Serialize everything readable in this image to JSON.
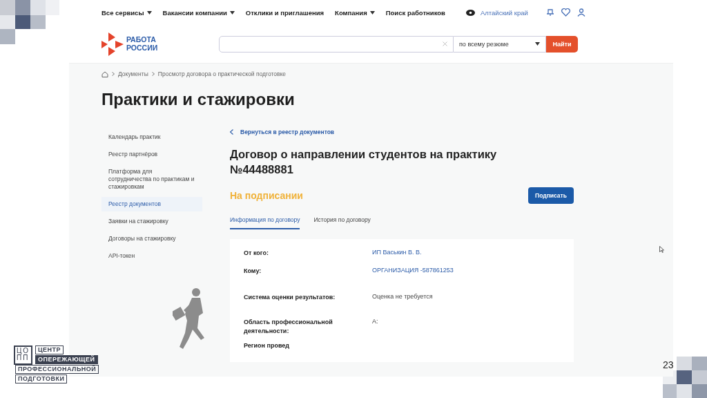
{
  "nav": {
    "items": [
      {
        "label": "Все сервисы",
        "dropdown": true
      },
      {
        "label": "Вакансии компании",
        "dropdown": true
      },
      {
        "label": "Отклики и приглашения",
        "dropdown": false
      },
      {
        "label": "Компания",
        "dropdown": true
      },
      {
        "label": "Поиск работников",
        "dropdown": false
      }
    ],
    "region": "Алтайский край"
  },
  "logo": {
    "lines": [
      "РАБОТА",
      "РОССИИ"
    ]
  },
  "search": {
    "scope": "по всему резюме",
    "button": "Найти"
  },
  "breadcrumb": [
    "Документы",
    "Просмотр договора о практической подготовке"
  ],
  "page_title": "Практики и стажировки",
  "sidebar": {
    "items": [
      {
        "label": "Календарь практик",
        "selected": false
      },
      {
        "label": "Реестр партнёров",
        "selected": false
      },
      {
        "label": "Платформа для сотрудничества по практикам и стажировкам",
        "selected": false
      },
      {
        "label": "Реестр документов",
        "selected": true
      },
      {
        "label": "Заявки на стажировку",
        "selected": false
      },
      {
        "label": "Договоры на стажировку",
        "selected": false
      },
      {
        "label": "API-токен",
        "selected": false
      }
    ]
  },
  "back_link": "Вернуться в реестр документов",
  "document": {
    "title_lines": [
      "Договор о направлении студентов на практику",
      "№44488881"
    ],
    "status": "На подписании",
    "action": "Подписать"
  },
  "tabs": [
    {
      "label": "Информация по договору",
      "selected": true
    },
    {
      "label": "История по договору",
      "selected": false
    }
  ],
  "fields": [
    {
      "label": "От кого:",
      "value": "ИП Васькин В. В.",
      "kind": "link"
    },
    {
      "label": "Кому:",
      "value": "ОРГАНИЗАЦИЯ -587861253",
      "kind": "link"
    },
    {
      "label": "Система оценки результатов:",
      "value": "Оценка не требуется",
      "kind": "text"
    },
    {
      "label": "Область профессиональной деятельности:",
      "value": "А:",
      "kind": "text"
    },
    {
      "label": "Регион провед"
    }
  ],
  "slide": {
    "page_number": "23",
    "logo_mark": [
      "ЦО",
      "ПП"
    ],
    "logo_lines": [
      {
        "text": "ЦЕНТР",
        "inverted": false
      },
      {
        "text": "ОПЕРЕЖАЮЩЕЙ",
        "inverted": true
      },
      {
        "text": "ПРОФЕССИОНАЛЬНОЙ",
        "inverted": false
      },
      {
        "text": "ПОДГОТОВКИ",
        "inverted": false
      }
    ]
  }
}
